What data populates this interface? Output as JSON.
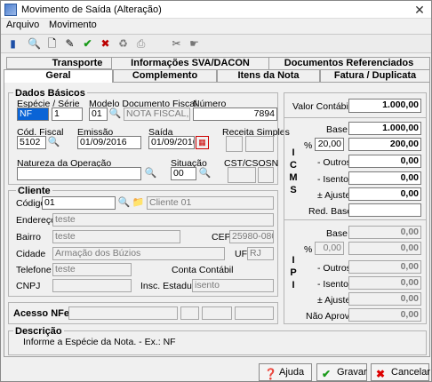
{
  "window": {
    "title": "Movimento de Saída (Alteração)",
    "close": "✕"
  },
  "menu": {
    "arquivo": "Arquivo",
    "movimento": "Movimento"
  },
  "tabs": {
    "transporte": "Transporte",
    "sva": "Informações SVA/DACON",
    "docs": "Documentos Referenciados",
    "geral": "Geral",
    "complemento": "Complemento",
    "itens": "Itens da Nota",
    "fatura": "Fatura / Duplicata"
  },
  "dados_basicos": {
    "title": "Dados Básicos",
    "especie_label": "Espécie / Série",
    "especie": "NF",
    "serie": "1",
    "modelo_label": "Modelo Documento Fiscal",
    "modelo_code": "01",
    "modelo_desc": "NOTA FISCAL, MI",
    "numero_label": "Número",
    "numero": "7894",
    "cod_fiscal_label": "Cód. Fiscal",
    "cod_fiscal": "5102",
    "emissao_label": "Emissão",
    "emissao": "01/09/2016",
    "saida_label": "Saída",
    "saida": "01/09/2016",
    "receita_label": "Receita Simples",
    "natureza_label": "Natureza da Operação",
    "natureza": "",
    "situacao_label": "Situação",
    "situacao": "00",
    "cst_label": "CST/CSOSN"
  },
  "cliente": {
    "title": "Cliente",
    "codigo_label": "Código",
    "codigo": "01",
    "nome": "Cliente 01",
    "endereco_label": "Endereço",
    "endereco": "teste",
    "bairro_label": "Bairro",
    "bairro": "teste",
    "cep_label": "CEP",
    "cep": "25980-080",
    "cidade_label": "Cidade",
    "cidade": "Armação dos Búzios",
    "uf_label": "UF",
    "uf": "RJ",
    "telefone_label": "Telefone",
    "telefone": "teste",
    "conta_label": "Conta Contábil",
    "cnpj_label": "CNPJ",
    "insc_label": "Insc. Estadual",
    "insc": "isento"
  },
  "acesso_label": "Acesso NFe",
  "valores": {
    "valor_contabil_label": "Valor Contábil",
    "valor_contabil": "1.000,00",
    "icms_letters": [
      "I",
      "C",
      "M",
      "S"
    ],
    "ipi_letters": [
      "I",
      "P",
      "I"
    ],
    "icms": {
      "base_label": "Base",
      "base": "1.000,00",
      "pct_label": "%",
      "pct": "20,00",
      "pct_value": "200,00",
      "outros_label": "- Outros",
      "outros": "0,00",
      "isento_label": "- Isento",
      "isento": "0,00",
      "ajuste_label": "± Ajuste",
      "ajuste": "0,00",
      "red_label": "Red. Base",
      "red": ""
    },
    "ipi": {
      "base_label": "Base",
      "base": "0,00",
      "pct_label": "%",
      "pct": "0,00",
      "pct_value": "0,00",
      "outros_label": "- Outros",
      "outros": "0,00",
      "isento_label": "- Isento",
      "isento": "0,00",
      "ajuste_label": "± Ajuste",
      "ajuste": "0,00",
      "nao_aprov_label": "Não Aprov.",
      "nao_aprov": "0,00"
    }
  },
  "descricao": {
    "title": "Descrição",
    "text": "Informe a Espécie da Nota. - Ex.: NF"
  },
  "buttons": {
    "ajuda": "Ajuda",
    "gravar": "Gravar",
    "cancelar": "Cancelar"
  }
}
